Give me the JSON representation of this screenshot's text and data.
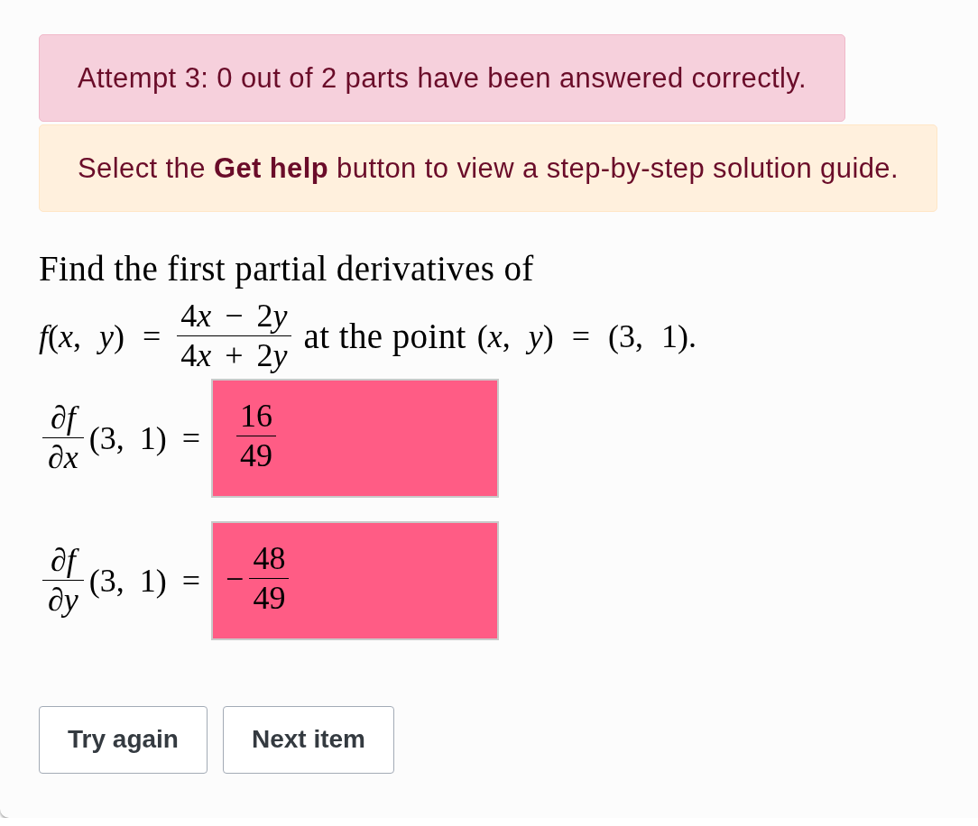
{
  "alerts": [
    {
      "kind": "error",
      "text": "Attempt 3: 0 out of 2 parts have been answered correctly."
    },
    {
      "kind": "warning",
      "text": "Select the **Get help** button to view a step-by-step solution guide."
    }
  ],
  "question": {
    "text": "Find the first partial derivatives of",
    "function": {
      "lhs": "f(x, y) =",
      "numerator": "4x − 2y",
      "denominator": "4x + 2y"
    },
    "connector": "at the point",
    "point": "(x, y) = (3, 1)."
  },
  "parts": [
    {
      "derivative": {
        "numerator": "∂f",
        "denominator": "∂x"
      },
      "at": "(3, 1) =",
      "correct": false,
      "answer": {
        "numerator": "16",
        "denominator": "49"
      }
    },
    {
      "derivative": {
        "numerator": "∂f",
        "denominator": "∂y"
      },
      "at": "(3, 1) =",
      "correct": false,
      "answer": {
        "sign": "−",
        "numerator": "48",
        "denominator": "49"
      }
    }
  ],
  "buttons": [
    {
      "label": "Try again"
    },
    {
      "label": "Next item"
    }
  ]
}
